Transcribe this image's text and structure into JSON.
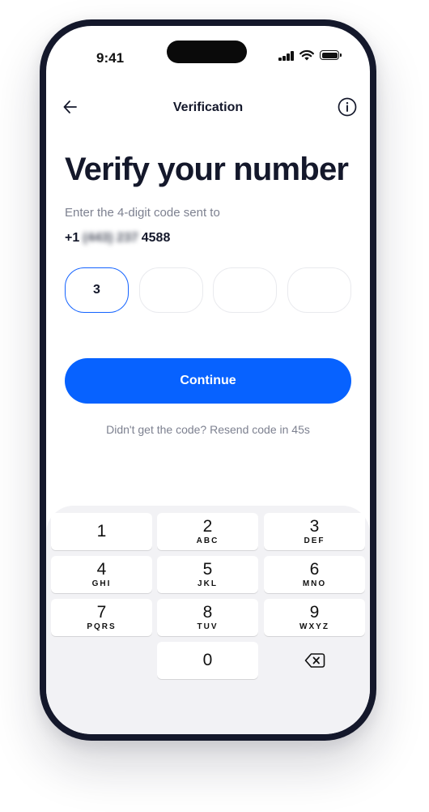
{
  "status_bar": {
    "time": "9:41"
  },
  "nav": {
    "title": "Verification"
  },
  "heading": {
    "title": "Verify your number"
  },
  "subtitle": "Enter the 4-digit code sent to",
  "phone": {
    "country_code": "+1",
    "masked_part": "(443) 237",
    "visible_suffix": "4588"
  },
  "otp": {
    "digits": [
      "3",
      "",
      "",
      ""
    ]
  },
  "continue_label": "Continue",
  "resend_text": "Didn't get the code? Resend code in 45s",
  "keypad": {
    "keys": [
      {
        "digit": "1",
        "letters": ""
      },
      {
        "digit": "2",
        "letters": "ABC"
      },
      {
        "digit": "3",
        "letters": "DEF"
      },
      {
        "digit": "4",
        "letters": "GHI"
      },
      {
        "digit": "5",
        "letters": "JKL"
      },
      {
        "digit": "6",
        "letters": "MNO"
      },
      {
        "digit": "7",
        "letters": "PQRS"
      },
      {
        "digit": "8",
        "letters": "TUV"
      },
      {
        "digit": "9",
        "letters": "WXYZ"
      },
      {
        "digit": "0",
        "letters": ""
      }
    ]
  },
  "colors": {
    "accent": "#0762ff",
    "text": "#14182b",
    "muted": "#7d8190",
    "frame": "#14182b"
  }
}
